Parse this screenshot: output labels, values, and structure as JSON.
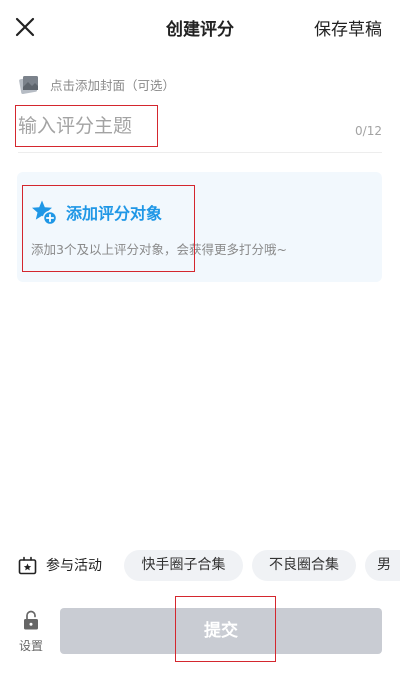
{
  "header": {
    "title": "创建评分",
    "save_draft_label": "保存草稿",
    "close_icon": "close-icon"
  },
  "cover": {
    "label": "点击添加封面（可选）",
    "icon": "image-cover-icon"
  },
  "topic": {
    "placeholder": "输入评分主题",
    "value": "",
    "char_count": "0/12"
  },
  "add_object": {
    "title": "添加评分对象",
    "hint": "添加3个及以上评分对象，会获得更多打分哦~",
    "icon": "star-add-icon"
  },
  "activity": {
    "label": "参与活动",
    "icon": "activity-icon",
    "chips": [
      {
        "label": "快手圈子合集"
      },
      {
        "label": "不良圈合集"
      },
      {
        "label": "男"
      }
    ]
  },
  "footer": {
    "settings_label": "设置",
    "settings_icon": "lock-open-icon",
    "submit_label": "提交"
  },
  "colors": {
    "accent_blue": "#1f97e6",
    "card_bg": "#f2f8fd",
    "submit_disabled": "#c9ccd3",
    "chip_bg": "#f0f2f5",
    "highlight_red": "#d4272e"
  }
}
